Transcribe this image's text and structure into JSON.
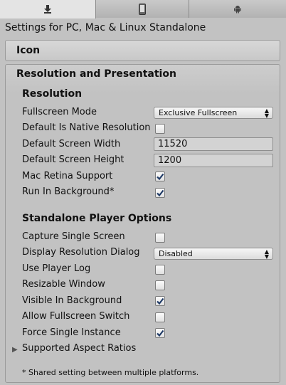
{
  "tabs": [
    {
      "icon": "download-arrow-icon",
      "active": true
    },
    {
      "icon": "mobile-device-icon",
      "active": false
    },
    {
      "icon": "android-robot-icon",
      "active": false
    }
  ],
  "header": {
    "settings_for": "Settings for PC, Mac & Linux Standalone"
  },
  "icon_panel": {
    "title": "Icon"
  },
  "resolution_panel": {
    "title": "Resolution and Presentation",
    "resolution_section": "Resolution",
    "fullscreen_mode": {
      "label": "Fullscreen Mode",
      "value": "Exclusive Fullscreen"
    },
    "default_is_native": {
      "label": "Default Is Native Resolution",
      "checked": false
    },
    "default_width": {
      "label": "Default Screen Width",
      "value": "11520"
    },
    "default_height": {
      "label": "Default Screen Height",
      "value": "1200"
    },
    "mac_retina": {
      "label": "Mac Retina Support",
      "checked": true
    },
    "run_in_background": {
      "label": "Run In Background*",
      "checked": true
    },
    "player_section": "Standalone Player Options",
    "capture_single_screen": {
      "label": "Capture Single Screen",
      "checked": false
    },
    "display_resolution_dialog": {
      "label": "Display Resolution Dialog",
      "value": "Disabled"
    },
    "use_player_log": {
      "label": "Use Player Log",
      "checked": false
    },
    "resizable_window": {
      "label": "Resizable Window",
      "checked": false
    },
    "visible_in_background": {
      "label": "Visible In Background",
      "checked": true
    },
    "allow_fullscreen_switch": {
      "label": "Allow Fullscreen Switch",
      "checked": false
    },
    "force_single_instance": {
      "label": "Force Single Instance",
      "checked": true
    },
    "supported_aspect_ratios": {
      "label": "Supported Aspect Ratios"
    },
    "footnote": "* Shared setting between multiple platforms."
  }
}
